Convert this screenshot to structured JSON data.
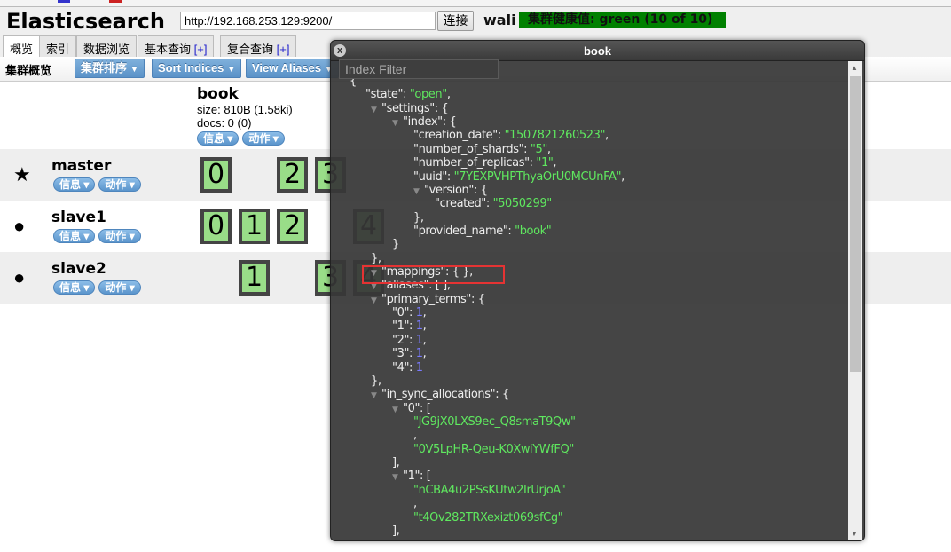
{
  "header": {
    "logo": "Elasticsearch",
    "url": "http://192.168.253.129:9200/",
    "connect": "连接",
    "cluster_name": "wali",
    "health": "集群健康值: green (10 of 10)",
    "health_color": "#008000"
  },
  "tabs": [
    {
      "label": "概览",
      "plus": ""
    },
    {
      "label": "索引",
      "plus": ""
    },
    {
      "label": "数据浏览",
      "plus": ""
    },
    {
      "label": "基本查询 ",
      "plus": "[+]"
    },
    {
      "label": "复合查询 ",
      "plus": "[+]"
    }
  ],
  "toolbar": {
    "title": "集群概览",
    "sort_cluster": "集群排序",
    "sort_indices": "Sort Indices",
    "view_aliases": "View Aliases",
    "filter_placeholder": "Index Filter"
  },
  "index": {
    "name": "book",
    "size": "size: 810B (1.58ki)",
    "docs": "docs: 0 (0)",
    "info": "信息",
    "action": "动作"
  },
  "nodes": [
    {
      "name": "master",
      "icon": "star-icon",
      "shards": [
        "0",
        "",
        "2",
        "3",
        ""
      ],
      "info": "信息",
      "action": "动作"
    },
    {
      "name": "slave1",
      "icon": "circle-icon",
      "shards": [
        "0",
        "1",
        "2",
        "",
        "4"
      ],
      "info": "信息",
      "action": "动作"
    },
    {
      "name": "slave2",
      "icon": "circle-icon",
      "shards": [
        "",
        "1",
        "",
        "3",
        "4"
      ],
      "info": "信息",
      "action": "动作"
    }
  ],
  "modal": {
    "title": "book",
    "close": "x",
    "lines": [
      {
        "d": 0,
        "p": "{"
      },
      {
        "d": 1,
        "k": "\"state\"",
        "v": "\"open\"",
        "vt": "s",
        "e": ","
      },
      {
        "d": 1,
        "t": 1,
        "k": "\"settings\"",
        "p": ": {"
      },
      {
        "d": 2,
        "t": 1,
        "k": "\"index\"",
        "p": ": {"
      },
      {
        "d": 3,
        "k": "\"creation_date\"",
        "v": "\"1507821260523\"",
        "vt": "s",
        "e": ","
      },
      {
        "d": 3,
        "k": "\"number_of_shards\"",
        "v": "\"5\"",
        "vt": "s",
        "e": ","
      },
      {
        "d": 3,
        "k": "\"number_of_replicas\"",
        "v": "\"1\"",
        "vt": "s",
        "e": ","
      },
      {
        "d": 3,
        "k": "\"uuid\"",
        "v": "\"7YEXPVHPThyaOrU0MCUnFA\"",
        "vt": "s",
        "e": ","
      },
      {
        "d": 3,
        "t": 1,
        "k": "\"version\"",
        "p": ": {"
      },
      {
        "d": 4,
        "k": "\"created\"",
        "v": "\"5050299\"",
        "vt": "s"
      },
      {
        "d": 3,
        "p": "},"
      },
      {
        "d": 3,
        "k": "\"provided_name\"",
        "v": "\"book\"",
        "vt": "s"
      },
      {
        "d": 2,
        "p": "}"
      },
      {
        "d": 1,
        "p": "},"
      },
      {
        "d": 1,
        "t": 1,
        "k": "\"mappings\"",
        "p": ": { },"
      },
      {
        "d": 1,
        "t": 1,
        "k": "\"aliases\"",
        "p": ": [ ],"
      },
      {
        "d": 1,
        "t": 1,
        "k": "\"primary_terms\"",
        "p": ": {"
      },
      {
        "d": 2,
        "k": "\"0\"",
        "v": "1",
        "vt": "n",
        "e": ","
      },
      {
        "d": 2,
        "k": "\"1\"",
        "v": "1",
        "vt": "n",
        "e": ","
      },
      {
        "d": 2,
        "k": "\"2\"",
        "v": "1",
        "vt": "n",
        "e": ","
      },
      {
        "d": 2,
        "k": "\"3\"",
        "v": "1",
        "vt": "n",
        "e": ","
      },
      {
        "d": 2,
        "k": "\"4\"",
        "v": "1",
        "vt": "n"
      },
      {
        "d": 1,
        "p": "},"
      },
      {
        "d": 1,
        "t": 1,
        "k": "\"in_sync_allocations\"",
        "p": ": {"
      },
      {
        "d": 2,
        "t": 1,
        "k": "\"0\"",
        "p": ": ["
      },
      {
        "d": 3,
        "sv": "\"JG9jX0LXS9ec_Q8smaT9Qw\""
      },
      {
        "d": 3,
        "p": ","
      },
      {
        "d": 3,
        "sv": "\"0V5LpHR-Qeu-K0XwiYWfFQ\""
      },
      {
        "d": 2,
        "p": "],"
      },
      {
        "d": 2,
        "t": 1,
        "k": "\"1\"",
        "p": ": ["
      },
      {
        "d": 3,
        "sv": "\"nCBA4u2PSsKUtw2IrUrjoA\""
      },
      {
        "d": 3,
        "p": ","
      },
      {
        "d": 3,
        "sv": "\"t4Ov282TRXexizt069sfCg\""
      },
      {
        "d": 2,
        "p": "],"
      }
    ]
  }
}
